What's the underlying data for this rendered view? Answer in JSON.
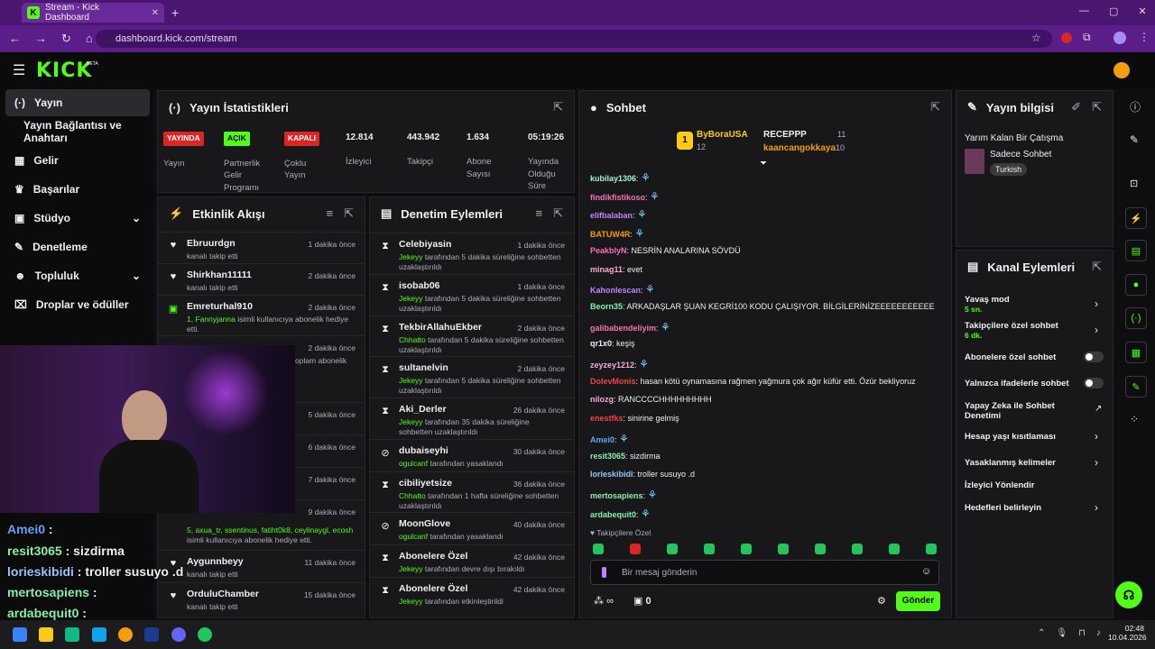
{
  "browser": {
    "tab_title": "Stream - Kick Dashboard",
    "new_tab": "+",
    "url": "dashboard.kick.com/stream"
  },
  "brand": {
    "logo": "KICK",
    "beta": "BETA",
    "accent": "#53fc18"
  },
  "sidebar": {
    "items": [
      {
        "label": "Yayın",
        "icon": "broadcast-icon"
      },
      {
        "label": "Yayın Bağlantısı ve Anahtarı",
        "icon": ""
      },
      {
        "label": "Gelir",
        "icon": "revenue-icon"
      },
      {
        "label": "Başarılar",
        "icon": "trophy-icon"
      },
      {
        "label": "Stüdyo",
        "icon": "studio-icon"
      },
      {
        "label": "Denetleme",
        "icon": "wrench-icon"
      },
      {
        "label": "Topluluk",
        "icon": "community-icon"
      },
      {
        "label": "Droplar ve ödüller",
        "icon": "gift-icon"
      }
    ]
  },
  "stats": {
    "title": "Yayın İstatistikleri",
    "items": [
      {
        "badge": "YAYINDA",
        "label": "Yayın"
      },
      {
        "badge": "AÇIK",
        "label": "Partnerlik Gelir Programı"
      },
      {
        "badge": "KAPALI",
        "label": "Çoklu Yayın"
      },
      {
        "value": "12.814",
        "label": "İzleyici"
      },
      {
        "value": "443.942",
        "label": "Takipçi"
      },
      {
        "value": "1.634",
        "label": "Abone Sayısı"
      },
      {
        "value": "05:19:26",
        "label": "Yayında Olduğu Süre"
      }
    ]
  },
  "activity": {
    "title": "Etkinlik Akışı",
    "rows": [
      {
        "name": "Ebruurdgn",
        "time": "1 dakika önce",
        "sub": "kanalı takip etti"
      },
      {
        "name": "Shirkhan11111",
        "time": "2 dakika önce",
        "sub": "kanalı takip etti"
      },
      {
        "name": "Emreturhal910",
        "time": "2 dakika önce",
        "sub_green": "1, Fannyjanna",
        "sub": " isimli kullanıcıya abonelik hediye etti."
      },
      {
        "name": "",
        "time": "2 dakika önce",
        "sub": "oplam abonelik"
      },
      {
        "name": "",
        "time": "5 dakika önce",
        "sub": ""
      },
      {
        "name": "",
        "time": "6 dakika önce",
        "sub": ""
      },
      {
        "name": "",
        "time": "7 dakika önce",
        "sub": ""
      },
      {
        "name": "",
        "time": "9 dakika önce",
        "sub_green": "5, axua_tr, ssentinus, fatiht0k8, ceylinaygl, ecosh",
        "sub": " isimli kullanıcıya abonelik hediye etti."
      },
      {
        "name": "Aygunnbeyy",
        "time": "11 dakika önce",
        "sub": "kanalı takip etti"
      },
      {
        "name": "OrduluChamber",
        "time": "15 dakika önce",
        "sub": "kanalı takip etti"
      }
    ]
  },
  "moderation": {
    "title": "Denetim Eylemleri",
    "rows": [
      {
        "name": "Celebiyasin",
        "time": "1 dakika önce",
        "actor": "Jekeyy",
        "sub": " tarafından 5 dakika süreliğine sohbetten uzaklaştırıldı"
      },
      {
        "name": "isobab06",
        "time": "1 dakika önce",
        "actor": "Jekeyy",
        "sub": " tarafından 5 dakika süreliğine sohbetten uzaklaştırıldı"
      },
      {
        "name": "TekbirAllahuEkber",
        "time": "2 dakika önce",
        "actor": "Chhatto",
        "sub": " tarafından 5 dakika süreliğine sohbetten uzaklaştırıldı"
      },
      {
        "name": "sultanelvin",
        "time": "2 dakika önce",
        "actor": "Jekeyy",
        "sub": " tarafından 5 dakika süreliğine sohbetten uzaklaştırıldı"
      },
      {
        "name": "Aki_Derler",
        "time": "26 dakika önce",
        "actor": "Jekeyy",
        "sub": " tarafından 35 dakika süreliğine sohbetten uzaklaştırıldı"
      },
      {
        "name": "dubaiseyhi",
        "time": "30 dakika önce",
        "actor": "ogulcanf",
        "sub": " tarafından yasaklandı"
      },
      {
        "name": "cibiliyetsize",
        "time": "36 dakika önce",
        "actor": "Chhatto",
        "sub": " tarafından 1 hafta süreliğine sohbetten uzaklaştırıldı"
      },
      {
        "name": "MoonGlove",
        "time": "40 dakika önce",
        "actor": "ogulcanf",
        "sub": " tarafından yasaklandı"
      },
      {
        "name": "Abonelere Özel",
        "time": "42 dakika önce",
        "actor": "Jekeyy",
        "sub": " tarafından devre dışı bırakıldı"
      },
      {
        "name": "Abonelere Özel",
        "time": "42 dakika önce",
        "actor": "Jekeyy",
        "sub": " tarafından etkinleştirildi"
      }
    ]
  },
  "chat": {
    "title": "Sohbet",
    "leader1": {
      "name": "ByBoraUSA",
      "count": "12"
    },
    "leader2": {
      "name": "RECEPPP",
      "count": "11"
    },
    "leader3": {
      "name": "kaancangokkaya",
      "count": "10"
    },
    "lines": [
      {
        "user": "kubilay1306",
        "color": "#a7f3d0",
        "text": ""
      },
      {
        "user": "findikfistikoso",
        "color": "#f472b6",
        "text": ""
      },
      {
        "user": "elifbalaban",
        "color": "#c084fc",
        "text": ""
      },
      {
        "user": "BATUW4R",
        "color": "#f59e0b",
        "text": ""
      },
      {
        "user": "PeakblyN",
        "color": "#f472b6",
        "text": "NESRİN ANALARINA SÖVDÜ"
      },
      {
        "user": "minag11",
        "color": "#f9a8d4",
        "text": "evet"
      },
      {
        "user": "Kahonlescan",
        "color": "#c084fc",
        "text": ""
      },
      {
        "user": "Beorn35",
        "color": "#86efac",
        "text": "ARKADAŞLAR ŞUAN KEGRİ100 KODU ÇALIŞIYOR. BİLGİLERİNİZEEEEEEEEEEE"
      },
      {
        "user": "galibabendeliyim",
        "color": "#f472b6",
        "text": ""
      },
      {
        "user": "qr1x0",
        "color": "#efeff1",
        "text": "keşiş"
      },
      {
        "user": "zeyzey1212",
        "color": "#f9a8d4",
        "text": ""
      },
      {
        "user": "DolevMonis",
        "color": "#ef4444",
        "text": "hasan kötü oynamasına rağmen yağmura çok ağır küfür etti. Özür bekliyoruz"
      },
      {
        "user": "nilozg",
        "color": "#f9a8d4",
        "text": "RANCCCCHHHHHHHHH"
      },
      {
        "user": "enestfks",
        "color": "#ef4444",
        "text": "sinirine gelmiş"
      },
      {
        "user": "Amei0",
        "color": "#60a5fa",
        "text": ""
      },
      {
        "user": "resit3065",
        "color": "#86efac",
        "text": "sizdirma"
      },
      {
        "user": "lorieskibidi",
        "color": "#93c5fd",
        "text": "troller susuyo .d"
      },
      {
        "user": "mertosapiens",
        "color": "#86efac",
        "text": ""
      },
      {
        "user": "ardabequit0",
        "color": "#86efac",
        "text": ""
      }
    ],
    "followers_only": "Takipçilere Özel",
    "placeholder": "Bir mesaj gönderin",
    "points": "∞",
    "gift_count": "0",
    "send": "Gönder"
  },
  "stream_info": {
    "title": "Yayın bilgisi",
    "stream_title": "Yarım Kalan Bir Çatışma",
    "category": "Sadece Sohbet",
    "language": "Turkish"
  },
  "channel_actions": {
    "title": "Kanal Eylemleri",
    "items": [
      {
        "label": "Yavaş mod",
        "sub": "5 sn."
      },
      {
        "label": "Takipçilere özel sohbet",
        "sub": "6 dk."
      },
      {
        "label": "Abonelere özel sohbet",
        "sub": ""
      },
      {
        "label": "Yalnızca ifadelerle sohbet",
        "sub": ""
      },
      {
        "label": "Yapay Zeka ile Sohbet Denetimi",
        "sub": ""
      },
      {
        "label": "Hesap yaşı kısıtlaması",
        "sub": ""
      },
      {
        "label": "Yasaklanmış kelimeler",
        "sub": ""
      },
      {
        "label": "İzleyici Yönlendir",
        "sub": ""
      },
      {
        "label": "Hedefleri belirleyin",
        "sub": ""
      }
    ]
  },
  "overlay_chat": [
    {
      "user": "Amei0",
      "color": "#60a5fa"
    },
    {
      "user": "resit3065",
      "color": "#86efac",
      "text": "sizdirma"
    },
    {
      "user": "lorieskibidi",
      "color": "#93c5fd",
      "text": "troller susuyo .d"
    },
    {
      "user": "mertosapiens",
      "color": "#86efac"
    },
    {
      "user": "ardabequit0",
      "color": "#86efac"
    }
  ],
  "taskbar": {
    "time": "02:48",
    "date": "10.04.2026"
  }
}
